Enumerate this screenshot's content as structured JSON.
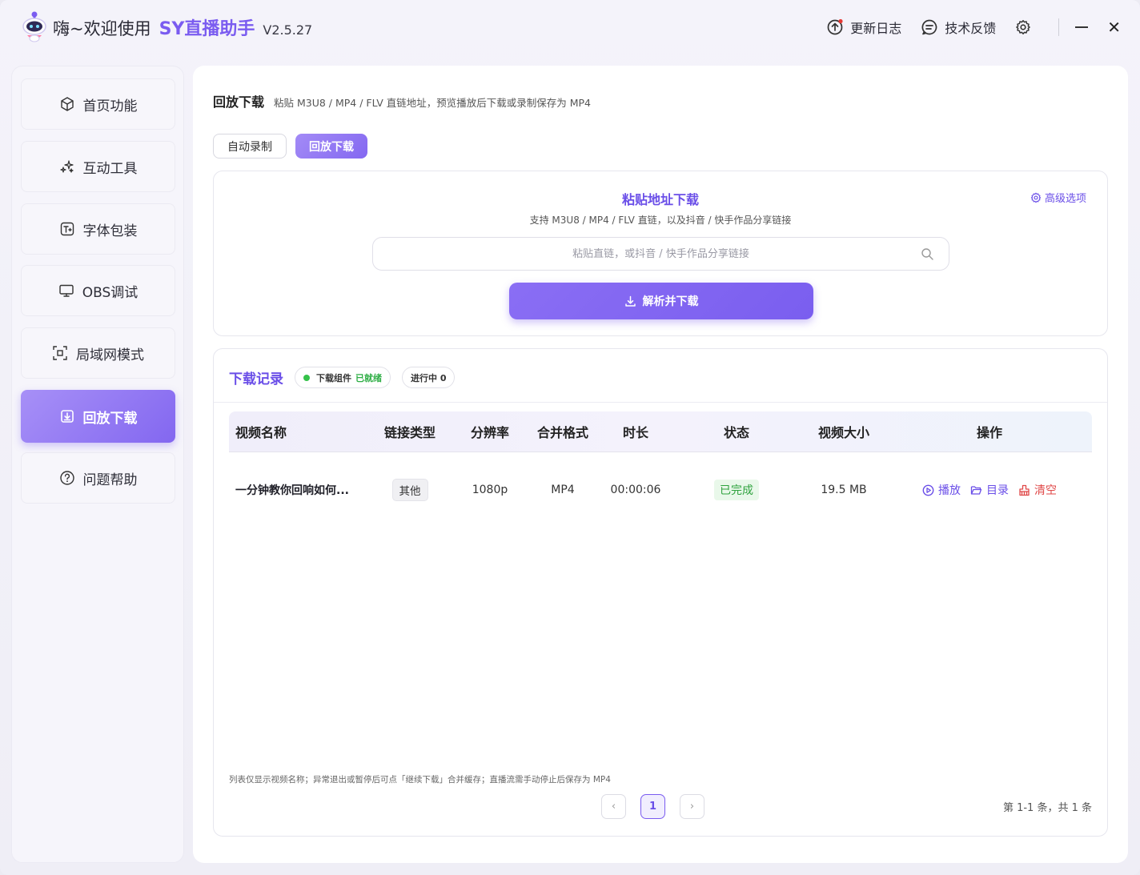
{
  "titlebar": {
    "greeting": "嗨~欢迎使用",
    "brand": "SY直播助手",
    "version": "V2.5.27",
    "changelog": "更新日志",
    "feedback": "技术反馈"
  },
  "sidebar": {
    "items": [
      {
        "label": "首页功能",
        "icon": "cube-icon"
      },
      {
        "label": "互动工具",
        "icon": "sparkles-icon"
      },
      {
        "label": "字体包装",
        "icon": "text-icon"
      },
      {
        "label": "OBS调试",
        "icon": "monitor-icon"
      },
      {
        "label": "局域网模式",
        "icon": "lan-icon"
      },
      {
        "label": "回放下载",
        "icon": "download-box-icon",
        "active": true
      },
      {
        "label": "问题帮助",
        "icon": "help-icon"
      }
    ]
  },
  "page": {
    "title": "回放下载",
    "subtitle": "粘贴 M3U8 / MP4 / FLV 直链地址，预览播放后下载或录制保存为 MP4",
    "tabs": [
      {
        "label": "自动录制",
        "active": false
      },
      {
        "label": "回放下载",
        "active": true
      }
    ]
  },
  "paste": {
    "title": "粘贴地址下载",
    "subtitle": "支持 M3U8 / MP4 / FLV 直链，以及抖音 / 快手作品分享链接",
    "advanced": "高级选项",
    "placeholder": "粘贴直链，或抖音 / 快手作品分享链接",
    "value": "",
    "button": "解析并下载"
  },
  "records": {
    "title": "下载记录",
    "component_label": "下载组件",
    "component_status": "已就绪",
    "in_progress": "进行中 0",
    "columns": {
      "name": "视频名称",
      "type": "链接类型",
      "resolution": "分辨率",
      "format": "合并格式",
      "duration": "时长",
      "status": "状态",
      "size": "视频大小",
      "ops": "操作"
    },
    "rows": [
      {
        "name": "一分钟教你回响如何...",
        "type": "其他",
        "resolution": "1080p",
        "format": "MP4",
        "duration": "00:00:06",
        "status": "已完成",
        "size": "19.5 MB",
        "op_play": "播放",
        "op_dir": "目录",
        "op_clear": "清空"
      }
    ],
    "footnote": "列表仅显示视频名称；异常退出或暂停后可点「继续下载」合并缓存；直播流需手动停止后保存为 MP4",
    "pager": {
      "prev": "‹",
      "current": "1",
      "next": "›"
    },
    "total": "第 1-1 条，共 1 条"
  }
}
